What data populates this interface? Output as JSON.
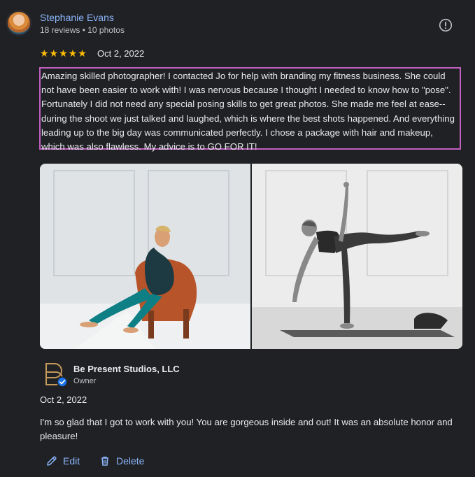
{
  "reviewer": {
    "name": "Stephanie Evans",
    "meta": "18 reviews • 10 photos"
  },
  "review": {
    "stars": "★★★★★",
    "rating": 5,
    "date": "Oct 2, 2022",
    "text": "Amazing skilled photographer! I contacted Jo for help with branding my fitness business. She could not have been easier to work with! I was nervous because I thought I needed to know how to \"pose\". Fortunately I did not need any special posing skills to get great photos. She made me feel at ease--during the shoot we just talked and laughed, which is where the best shots happened. And everything leading up to the big day was communicated perfectly. I chose a package with hair and makeup, which was also flawless. My advice is to GO FOR IT!"
  },
  "owner_response": {
    "name": "Be Present Studios, LLC",
    "role": "Owner",
    "date": "Oct 2, 2022",
    "text": "I'm so glad that I got to work with you! You are gorgeous inside and out! It was an absolute honor and pleasure!"
  },
  "actions": {
    "edit_label": "Edit",
    "delete_label": "Delete"
  },
  "colors": {
    "background": "#202124",
    "link": "#8ab4f8",
    "star": "#fbbc04",
    "highlight_border": "#c060c0"
  },
  "icons": [
    "report-icon",
    "edit-icon",
    "delete-icon",
    "verified-badge-icon"
  ]
}
